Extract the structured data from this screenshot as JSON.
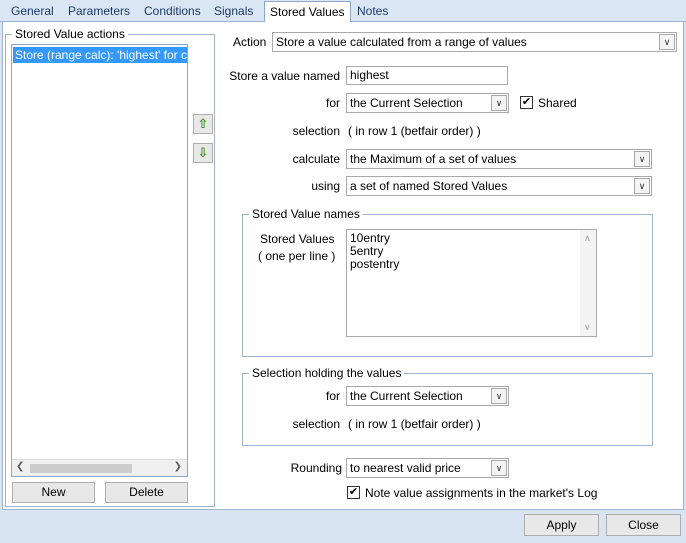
{
  "tabs": [
    {
      "label": "General"
    },
    {
      "label": "Parameters"
    },
    {
      "label": "Conditions"
    },
    {
      "label": "Signals"
    },
    {
      "label": "Stored Values"
    },
    {
      "label": "Notes"
    }
  ],
  "actions_group": {
    "legend": "Stored Value actions",
    "items": [
      "Store (range calc): 'highest' for current Selection"
    ],
    "new_label": "New",
    "delete_label": "Delete"
  },
  "form": {
    "action_label": "Action",
    "action_value": "Store a value calculated from a range of values",
    "store_named_label": "Store a value named",
    "store_named_value": "highest",
    "for_label": "for",
    "for_value": "the Current Selection",
    "shared_label": "Shared",
    "shared_checked": "✔",
    "selection_label": "selection",
    "selection_value": "( in row 1 (betfair order) )",
    "calculate_label": "calculate",
    "calculate_value": "the Maximum of a set of values",
    "using_label": "using",
    "using_value": "a set of named Stored Values"
  },
  "names_group": {
    "legend": "Stored Value names",
    "label1": "Stored Values",
    "label2": "( one per line )",
    "lines": [
      "10entry",
      "5entry",
      "postentry"
    ]
  },
  "holding_group": {
    "legend": "Selection holding the values",
    "for_label": "for",
    "for_value": "the Current Selection",
    "selection_label": "selection",
    "selection_value": "( in row 1 (betfair order) )"
  },
  "rounding": {
    "label": "Rounding",
    "value": "to nearest valid price"
  },
  "log_note": {
    "label": "Note value assignments in the market's Log",
    "checked": "✔"
  },
  "footer": {
    "apply_label": "Apply",
    "close_label": "Close"
  },
  "icons": {
    "move_up": "arrow-up-icon",
    "move_down": "arrow-down-icon",
    "move_up_glyph": "⇧",
    "move_down_glyph": "⇩",
    "dropdown_glyph": "∨"
  },
  "colors": {
    "selection": "#3399ff",
    "arrows": "#3a8f1c"
  }
}
